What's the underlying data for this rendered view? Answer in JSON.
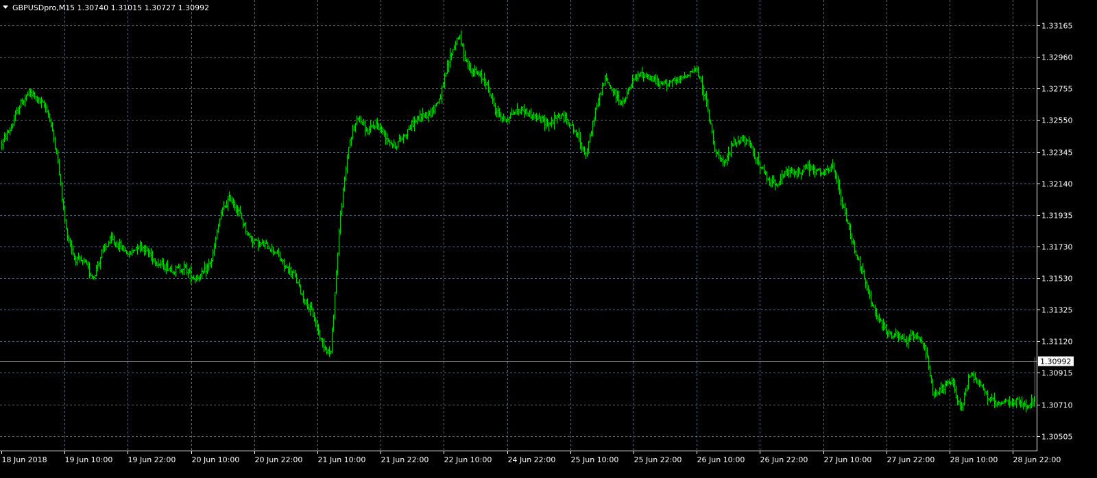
{
  "header": {
    "dropdown_icon": "triangle-down-icon",
    "title": "GBPUSDpro,M15  1.30740 1.31015 1.30727 1.30992"
  },
  "colors": {
    "background": "#000000",
    "grid": "#5c6b7a",
    "series": "#00d000",
    "axis_text": "#ffffff",
    "current_price_line": "#8ea6bd",
    "badge_bg": "#ffffff"
  },
  "chart_data": {
    "type": "bar",
    "symbol": "GBPUSDpro",
    "timeframe": "M15",
    "ohlc_last": {
      "open": 1.3074,
      "high": 1.31015,
      "low": 1.30727,
      "close": 1.30992
    },
    "current_price": 1.30992,
    "current_price_label": "1.30992",
    "ylim": [
      1.3042,
      1.3331
    ],
    "grid": true,
    "y_ticks": [
      {
        "value": 1.33165,
        "label": "1.33165"
      },
      {
        "value": 1.3296,
        "label": "1.32960"
      },
      {
        "value": 1.32755,
        "label": "1.32755"
      },
      {
        "value": 1.3255,
        "label": "1.32550"
      },
      {
        "value": 1.32345,
        "label": "1.32345"
      },
      {
        "value": 1.3214,
        "label": "1.32140"
      },
      {
        "value": 1.31935,
        "label": "1.31935"
      },
      {
        "value": 1.3173,
        "label": "1.31730"
      },
      {
        "value": 1.3153,
        "label": "1.31530"
      },
      {
        "value": 1.31325,
        "label": "1.31325"
      },
      {
        "value": 1.3112,
        "label": "1.31120"
      },
      {
        "value": 1.30915,
        "label": "1.30915"
      },
      {
        "value": 1.3071,
        "label": "1.30710"
      },
      {
        "value": 1.30505,
        "label": "1.30505"
      }
    ],
    "x_ticks": [
      {
        "label": "18 Jun 2018"
      },
      {
        "label": "19 Jun 10:00"
      },
      {
        "label": "19 Jun 22:00"
      },
      {
        "label": "20 Jun 10:00"
      },
      {
        "label": "20 Jun 22:00"
      },
      {
        "label": "21 Jun 10:00"
      },
      {
        "label": "21 Jun 22:00"
      },
      {
        "label": "22 Jun 10:00"
      },
      {
        "label": "24 Jun 22:00"
      },
      {
        "label": "25 Jun 10:00"
      },
      {
        "label": "25 Jun 22:00"
      },
      {
        "label": "26 Jun 10:00"
      },
      {
        "label": "26 Jun 22:00"
      },
      {
        "label": "27 Jun 10:00"
      },
      {
        "label": "27 Jun 22:00"
      },
      {
        "label": "28 Jun 10:00"
      },
      {
        "label": "28 Jun 22:00"
      }
    ],
    "price_path": [
      [
        0,
        1.324
      ],
      [
        1,
        1.325
      ],
      [
        2,
        1.3265
      ],
      [
        3,
        1.3273
      ],
      [
        4,
        1.3268
      ],
      [
        5,
        1.3262
      ],
      [
        6,
        1.3235
      ],
      [
        7,
        1.3185
      ],
      [
        8,
        1.3165
      ],
      [
        9,
        1.3163
      ],
      [
        10,
        1.3153
      ],
      [
        11,
        1.317
      ],
      [
        12,
        1.3178
      ],
      [
        13,
        1.3173
      ],
      [
        14,
        1.3168
      ],
      [
        15,
        1.3175
      ],
      [
        16,
        1.317
      ],
      [
        17,
        1.3163
      ],
      [
        18,
        1.316
      ],
      [
        19,
        1.3158
      ],
      [
        20,
        1.316
      ],
      [
        21,
        1.3153
      ],
      [
        22,
        1.3155
      ],
      [
        23,
        1.3165
      ],
      [
        24,
        1.3195
      ],
      [
        25,
        1.3205
      ],
      [
        26,
        1.3195
      ],
      [
        27,
        1.318
      ],
      [
        28,
        1.3175
      ],
      [
        29,
        1.3174
      ],
      [
        30,
        1.317
      ],
      [
        31,
        1.316
      ],
      [
        32,
        1.3155
      ],
      [
        33,
        1.314
      ],
      [
        34,
        1.313
      ],
      [
        35,
        1.3112
      ],
      [
        36,
        1.3103
      ],
      [
        37,
        1.319
      ],
      [
        38,
        1.324
      ],
      [
        39,
        1.3258
      ],
      [
        40,
        1.3247
      ],
      [
        41,
        1.3253
      ],
      [
        42,
        1.3245
      ],
      [
        43,
        1.3238
      ],
      [
        44,
        1.3245
      ],
      [
        45,
        1.3253
      ],
      [
        46,
        1.3258
      ],
      [
        47,
        1.326
      ],
      [
        48,
        1.327
      ],
      [
        49,
        1.3295
      ],
      [
        50,
        1.331
      ],
      [
        51,
        1.329
      ],
      [
        52,
        1.3285
      ],
      [
        53,
        1.328
      ],
      [
        54,
        1.3262
      ],
      [
        55,
        1.3255
      ],
      [
        56,
        1.326
      ],
      [
        57,
        1.3262
      ],
      [
        58,
        1.3258
      ],
      [
        59,
        1.3255
      ],
      [
        60,
        1.3253
      ],
      [
        61,
        1.3258
      ],
      [
        62,
        1.3255
      ],
      [
        63,
        1.3245
      ],
      [
        64,
        1.3232
      ],
      [
        65,
        1.3262
      ],
      [
        66,
        1.3282
      ],
      [
        67,
        1.3273
      ],
      [
        68,
        1.3265
      ],
      [
        69,
        1.328
      ],
      [
        70,
        1.3285
      ],
      [
        71,
        1.3283
      ],
      [
        72,
        1.3278
      ],
      [
        73,
        1.328
      ],
      [
        74,
        1.328
      ],
      [
        75,
        1.3285
      ],
      [
        76,
        1.3288
      ],
      [
        77,
        1.327
      ],
      [
        78,
        1.3238
      ],
      [
        79,
        1.3225
      ],
      [
        80,
        1.324
      ],
      [
        81,
        1.3243
      ],
      [
        82,
        1.3238
      ],
      [
        83,
        1.3225
      ],
      [
        84,
        1.3215
      ],
      [
        85,
        1.3215
      ],
      [
        86,
        1.3222
      ],
      [
        87,
        1.322
      ],
      [
        88,
        1.3225
      ],
      [
        89,
        1.3222
      ],
      [
        90,
        1.322
      ],
      [
        91,
        1.3225
      ],
      [
        92,
        1.32
      ],
      [
        93,
        1.3178
      ],
      [
        94,
        1.316
      ],
      [
        95,
        1.314
      ],
      [
        96,
        1.3125
      ],
      [
        97,
        1.3117
      ],
      [
        98,
        1.3115
      ],
      [
        99,
        1.3112
      ],
      [
        100,
        1.3117
      ],
      [
        101,
        1.311
      ],
      [
        102,
        1.3075
      ],
      [
        103,
        1.3082
      ],
      [
        104,
        1.3085
      ],
      [
        105,
        1.3068
      ],
      [
        106,
        1.3092
      ],
      [
        107,
        1.3085
      ],
      [
        108,
        1.3075
      ],
      [
        109,
        1.307
      ],
      [
        110,
        1.3072
      ],
      [
        111,
        1.3073
      ],
      [
        112,
        1.307
      ],
      [
        113,
        1.3074
      ]
    ]
  }
}
